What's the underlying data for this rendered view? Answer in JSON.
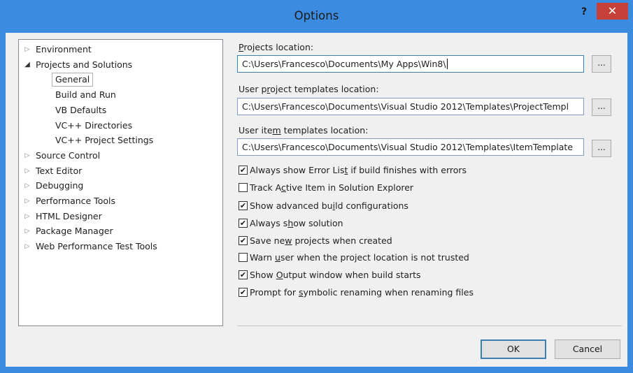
{
  "window": {
    "title": "Options",
    "help_label": "?",
    "close_label": "✕"
  },
  "tree": {
    "items": [
      {
        "label": "Environment",
        "expander": "collapsed"
      },
      {
        "label": "Projects and Solutions",
        "expander": "expanded"
      },
      {
        "label": "General",
        "selected": true
      },
      {
        "label": "Build and Run"
      },
      {
        "label": "VB Defaults"
      },
      {
        "label": "VC++ Directories"
      },
      {
        "label": "VC++ Project Settings"
      },
      {
        "label": "Source Control",
        "expander": "collapsed"
      },
      {
        "label": "Text Editor",
        "expander": "collapsed"
      },
      {
        "label": "Debugging",
        "expander": "collapsed"
      },
      {
        "label": "Performance Tools",
        "expander": "collapsed"
      },
      {
        "label": "HTML Designer",
        "expander": "collapsed"
      },
      {
        "label": "Package Manager",
        "expander": "collapsed"
      },
      {
        "label": "Web Performance Test Tools",
        "expander": "collapsed"
      }
    ]
  },
  "settings": {
    "projects_location": {
      "label_mnemonic": "P",
      "label_rest": "rojects location:",
      "value": "C:\\Users\\Francesco\\Documents\\My Apps\\Win8\\"
    },
    "user_project_templates": {
      "label_pre": "User p",
      "label_mnemonic": "r",
      "label_rest": "oject templates location:",
      "value": "C:\\Users\\Francesco\\Documents\\Visual Studio 2012\\Templates\\ProjectTempl"
    },
    "user_item_templates": {
      "label_pre": "User ite",
      "label_mnemonic": "m",
      "label_rest": " templates location:",
      "value": "C:\\Users\\Francesco\\Documents\\Visual Studio 2012\\Templates\\ItemTemplate"
    },
    "browse_label": "...",
    "checkboxes": [
      {
        "pre": "Always show Error Lis",
        "mnemonic": "t",
        "post": " if build finishes with errors",
        "checked": true
      },
      {
        "pre": "Track A",
        "mnemonic": "c",
        "post": "tive Item in Solution Explorer",
        "checked": false
      },
      {
        "pre": "Show advanced bu",
        "mnemonic": "i",
        "post": "ld configurations",
        "checked": true
      },
      {
        "pre": "Always s",
        "mnemonic": "h",
        "post": "ow solution",
        "checked": true
      },
      {
        "pre": "Save ne",
        "mnemonic": "w",
        "post": " projects when created",
        "checked": true
      },
      {
        "pre": "Warn ",
        "mnemonic": "u",
        "post": "ser when the project location is not trusted",
        "checked": false
      },
      {
        "pre": "Show ",
        "mnemonic": "O",
        "post": "utput window when build starts",
        "checked": true
      },
      {
        "pre": "Prompt for ",
        "mnemonic": "s",
        "post": "ymbolic renaming when renaming files",
        "checked": true
      }
    ],
    "check_glyph": "✔"
  },
  "footer": {
    "ok_label": "OK",
    "cancel_label": "Cancel"
  }
}
